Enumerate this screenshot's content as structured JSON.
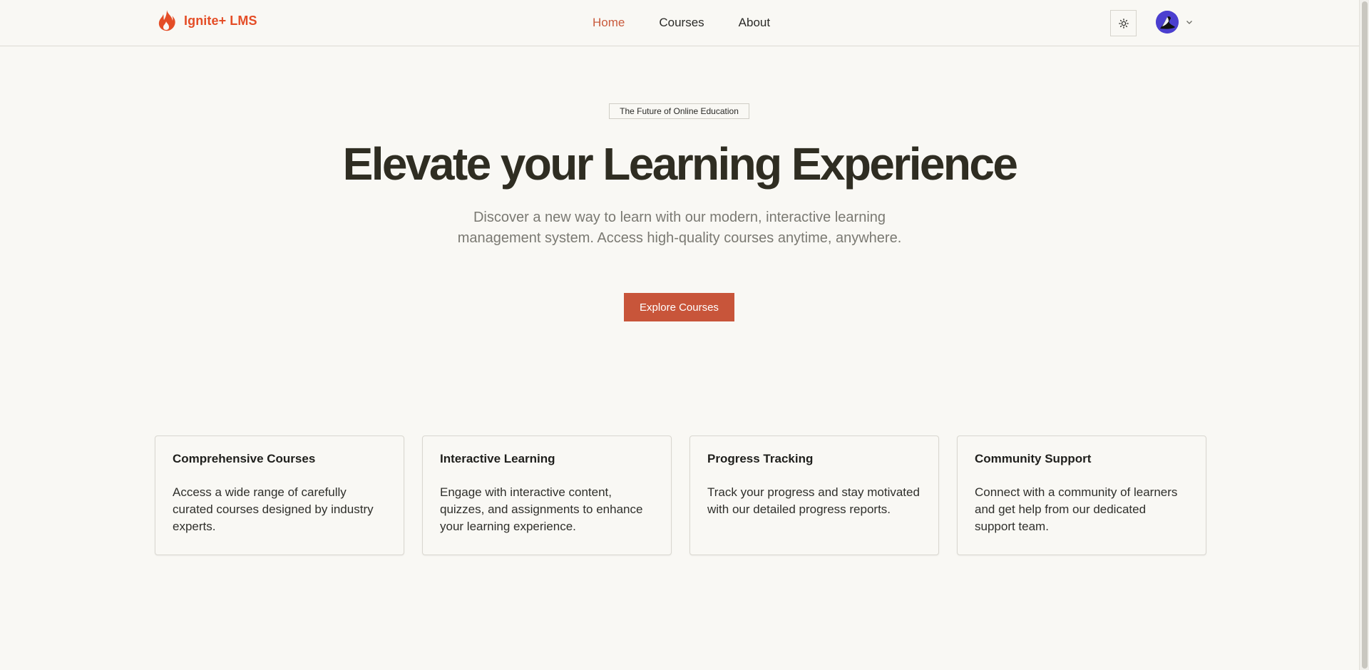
{
  "header": {
    "brand": "Ignite+ LMS",
    "nav": [
      {
        "label": "Home",
        "active": true
      },
      {
        "label": "Courses",
        "active": false
      },
      {
        "label": "About",
        "active": false
      }
    ],
    "theme_toggle_icon": "sun-icon",
    "avatar_icon": "user-avatar",
    "menu_icon": "chevron-down-icon"
  },
  "hero": {
    "badge": "The Future of Online Education",
    "title": "Elevate your Learning Experience",
    "subtitle": "Discover a new way to learn with our modern, interactive learning management system. Access high-quality courses anytime, anywhere.",
    "cta": "Explore Courses"
  },
  "features": [
    {
      "title": "Comprehensive Courses",
      "description": "Access a wide range of carefully curated courses designed by industry experts."
    },
    {
      "title": "Interactive Learning",
      "description": "Engage with interactive content, quizzes, and assignments to enhance your learning experience."
    },
    {
      "title": "Progress Tracking",
      "description": "Track your progress and stay motivated with our detailed progress reports."
    },
    {
      "title": "Community Support",
      "description": "Connect with a community of learners and get help from our dedicated support team."
    }
  ],
  "colors": {
    "accent": "#c8553a",
    "brand": "#e44d26",
    "background": "#f9f8f4"
  }
}
